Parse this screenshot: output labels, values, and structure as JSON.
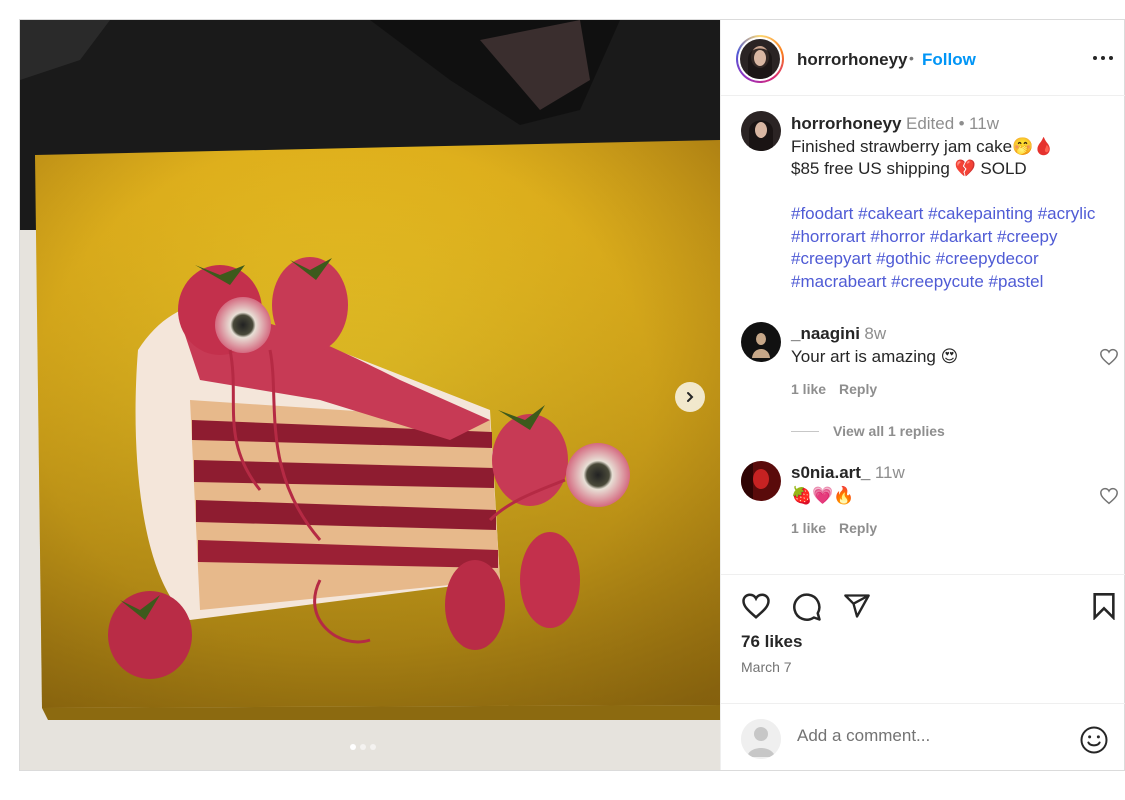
{
  "post": {
    "media_pages": 3,
    "media_active_page": 1
  },
  "header": {
    "username": "horrorhoneyy",
    "separator": "•",
    "follow_label": "Follow",
    "more_icon": "more-horizontal-icon"
  },
  "caption": {
    "username": "horrorhoneyy",
    "edited": "Edited",
    "dot": "•",
    "time": "11w",
    "line1": "Finished strawberry jam cake🤭🩸",
    "line2": "$85 free US shipping 💔 SOLD",
    "hashtags": [
      "#foodart",
      "#cakeart",
      "#cakepainting",
      "#acrylic",
      "#horrorart",
      "#horror",
      "#darkart",
      "#creepy",
      "#creepyart",
      "#gothic",
      "#creepydecor",
      "#macrabeart",
      "#creepycute",
      "#pastel"
    ]
  },
  "comments": [
    {
      "username": "_naagini",
      "time": "8w",
      "text": "Your art is amazing 😍",
      "likes": "1 like",
      "reply": "Reply",
      "view_replies": "View all 1 replies"
    },
    {
      "username": "s0nia.art_",
      "time": "11w",
      "text": "🍓💗🔥",
      "likes": "1 like",
      "reply": "Reply"
    }
  ],
  "actions": {
    "likes": "76 likes",
    "date": "March 7"
  },
  "comment_box": {
    "placeholder": "Add a comment...",
    "emoji_icon": "smiley-icon"
  },
  "colors": {
    "follow": "#0095f6",
    "hashtag": "#4f5bd5",
    "muted": "#737373"
  }
}
